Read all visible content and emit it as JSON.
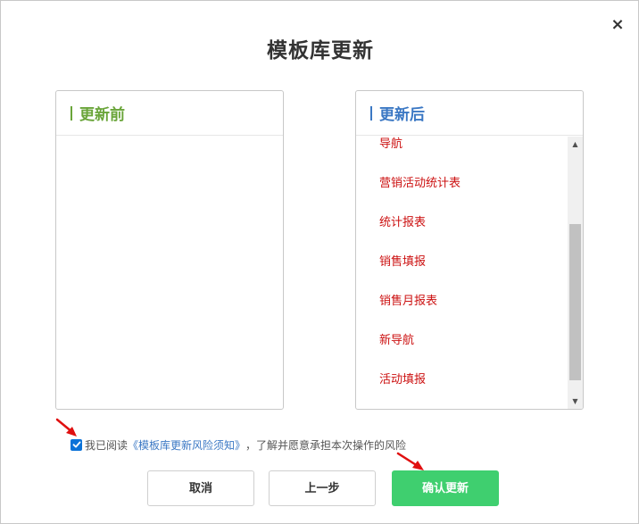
{
  "dialog": {
    "title": "模板库更新",
    "close_glyph": "×"
  },
  "panels": {
    "before": {
      "title": "更新前",
      "items": []
    },
    "after": {
      "title": "更新后",
      "items": [
        "导航",
        "营销活动统计表",
        "统计报表",
        "销售填报",
        "销售月报表",
        "新导航",
        "活动填报"
      ]
    }
  },
  "agreement": {
    "checked": true,
    "prefix": "我已阅读",
    "link": "《模板库更新风险须知》",
    "suffix": "，了解并愿意承担本次操作的风险"
  },
  "buttons": {
    "cancel": "取消",
    "prev": "上一步",
    "confirm": "确认更新"
  },
  "colors": {
    "before_accent": "#6aa53a",
    "after_accent": "#3b78c4",
    "item_text": "#cc1111",
    "confirm_bg": "#3fcf6f",
    "annotation_arrow": "#e01010"
  },
  "icons": {
    "close": "close-icon",
    "checkbox": "checkbox-checked-icon",
    "scroll_up": "scroll-up-arrow-icon",
    "scroll_down": "scroll-down-arrow-icon",
    "annotation": "red-arrow-annotation"
  }
}
